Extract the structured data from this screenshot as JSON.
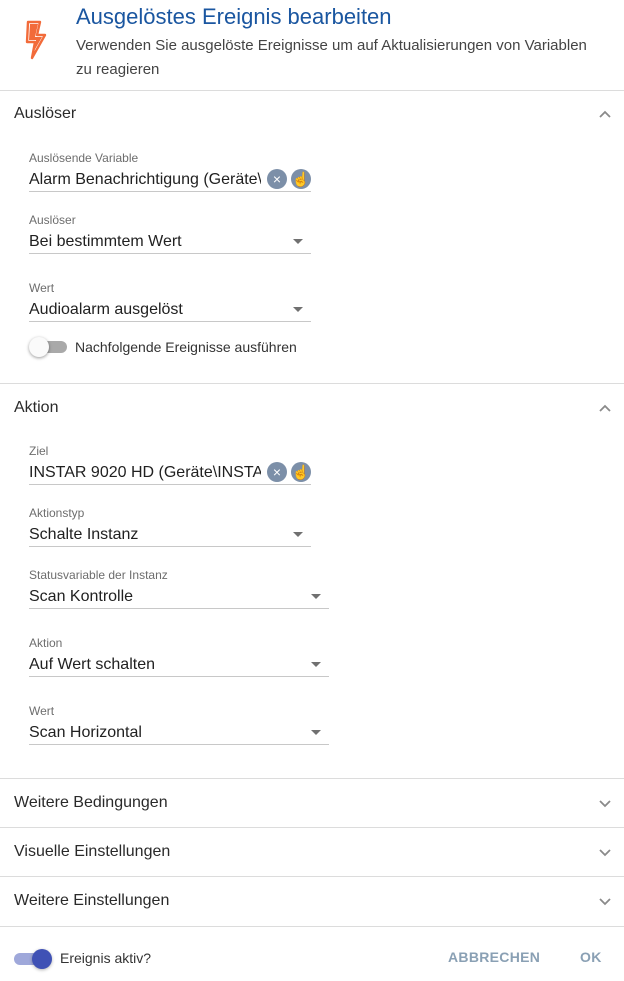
{
  "header": {
    "title": "Ausgelöstes Ereignis bearbeiten",
    "subtitle": "Verwenden Sie ausgelöste Ereignisse um auf Aktualisierungen von Variablen zu reagieren",
    "icon": "lightning-bolt-icon",
    "icon_color": "#f26b3a",
    "title_color": "#1a56a0"
  },
  "trigger_section": {
    "title": "Auslöser",
    "variable": {
      "label": "Auslösende Variable",
      "value": "Alarm Benachrichtigung (Geräte\\"
    },
    "trigger": {
      "label": "Auslöser",
      "value": "Bei bestimmtem Wert"
    },
    "value": {
      "label": "Wert",
      "value": "Audioalarm ausgelöst"
    },
    "subsequent": {
      "label": "Nachfolgende Ereignisse ausführen",
      "enabled": false
    }
  },
  "action_section": {
    "title": "Aktion",
    "target": {
      "label": "Ziel",
      "value": "INSTAR 9020 HD (Geräte\\INSTAR"
    },
    "action_type": {
      "label": "Aktionstyp",
      "value": "Schalte Instanz"
    },
    "status_variable": {
      "label": "Statusvariable der Instanz",
      "value": "Scan Kontrolle"
    },
    "action": {
      "label": "Aktion",
      "value": "Auf Wert schalten"
    },
    "value": {
      "label": "Wert",
      "value": "Scan Horizontal"
    }
  },
  "collapsed_sections": [
    {
      "title": "Weitere Bedingungen"
    },
    {
      "title": "Visuelle Einstellungen"
    },
    {
      "title": "Weitere Einstellungen"
    }
  ],
  "footer": {
    "active_label": "Ereignis aktiv?",
    "active": true,
    "cancel_label": "ABBRECHEN",
    "ok_label": "OK",
    "accent_color": "#3f51b5"
  }
}
